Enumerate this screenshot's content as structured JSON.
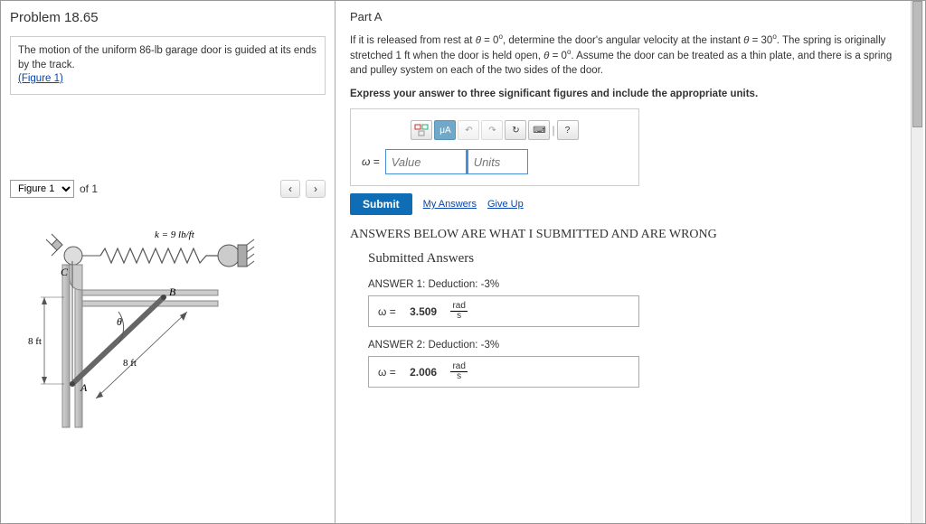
{
  "problem": {
    "title": "Problem 18.65",
    "description": "The motion of the uniform 86-lb garage door is guided at its ends by the track.",
    "figure_link": "(Figure 1)"
  },
  "figure": {
    "selector_label": "Figure 1",
    "of_label": "of 1",
    "k_label": "k = 9 lb/ft",
    "points": {
      "A": "A",
      "B": "B",
      "C": "C"
    },
    "dim1": "8 ft",
    "dim2": "8 ft",
    "theta": "θ"
  },
  "part": {
    "label": "Part A",
    "instruction_html": "If it is released from rest at θ = 0°, determine the door's angular velocity at the instant θ = 30°. The spring is originally stretched 1 ft when the door is held open, θ = 0°. Assume the door can be treated as a thin plate, and there is a spring and pulley system on each of the two sides of the door.",
    "express": "Express your answer to three significant figures and include the appropriate units."
  },
  "input": {
    "omega": "ω =",
    "value_ph": "Value",
    "units_ph": "Units",
    "toolbar": {
      "mu": "μA",
      "undo": "↶",
      "redo": "↷",
      "reset": "↻",
      "kb": "⌨",
      "sep": "|",
      "help": "?"
    }
  },
  "actions": {
    "submit": "Submit",
    "my_answers": "My Answers",
    "give_up": "Give Up"
  },
  "note": "ANSWERS BELOW ARE WHAT I SUBMITTED AND ARE WRONG",
  "submitted": {
    "heading": "Submitted Answers",
    "a1_label": "ANSWER 1: Deduction: -3%",
    "a1_val": "3.509",
    "a2_label": "ANSWER 2: Deduction: -3%",
    "a2_val": "2.006",
    "omega_eq": "ω =",
    "unit_num": "rad",
    "unit_den": "s"
  }
}
